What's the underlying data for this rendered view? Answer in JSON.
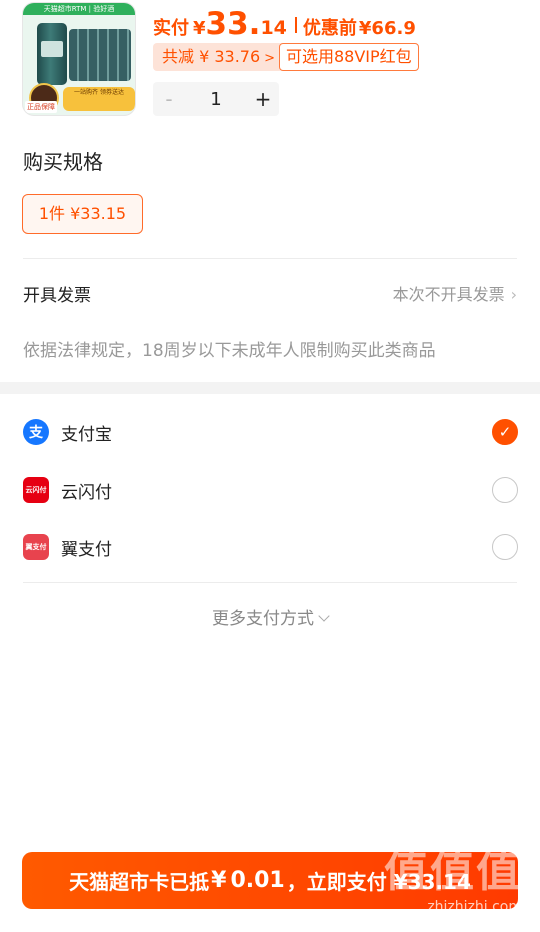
{
  "product": {
    "thumb_banner": "天猫超市RTM | 验好酒",
    "thumb_strip": "一站购齐 领券送达",
    "thumb_badge_text": "正品保障"
  },
  "price": {
    "pay_label": "实付",
    "currency": "¥",
    "pay_int": "33.",
    "pay_dec": "14",
    "orig_label": "优惠前",
    "orig_price": "¥66.9"
  },
  "discount": {
    "label": "共减 ¥ 33.76",
    "chevron": ">",
    "vip_label": "可选用88VIP红包"
  },
  "stepper": {
    "minus": "-",
    "value": "1",
    "plus": "+"
  },
  "spec": {
    "title": "购买规格",
    "option": "1件  ¥33.15"
  },
  "invoice": {
    "label": "开具发票",
    "value": "本次不开具发票",
    "chevron": "›"
  },
  "legal_note": "依据法律规定，18周岁以下未成年人限制购买此类商品",
  "payment": {
    "options": [
      {
        "name": "支付宝",
        "icon": "alipay-icon",
        "icon_text": "支",
        "checked": true
      },
      {
        "name": "云闪付",
        "icon": "unionpay-icon",
        "icon_text": "云闪付",
        "checked": false
      },
      {
        "name": "翼支付",
        "icon": "bestpay-icon",
        "icon_text": "翼支付",
        "checked": false
      }
    ],
    "check_glyph": "✓",
    "more_label": "更多支付方式"
  },
  "bottom": {
    "pre": "天猫超市卡已抵",
    "currency": "¥",
    "amount": "0.01",
    "post": "，立即支付 ¥33.14"
  },
  "watermark": {
    "main": "值值值",
    "url": "zhizhizhi.com"
  },
  "colors": {
    "accent": "#ff5000",
    "alipay": "#1677ff",
    "unionpay": "#e60012",
    "bestpay": "#e8434e"
  }
}
